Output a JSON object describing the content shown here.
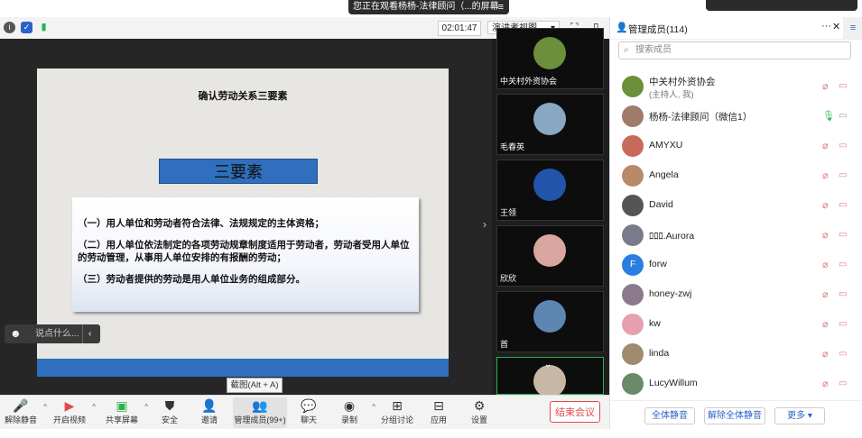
{
  "banner": {
    "share_text": "您正在观看杨杨-法律顾问（...的屏幕",
    "menu_icon": "≡"
  },
  "meeting_bar": {
    "timer": "02:01:47",
    "view_mode": "演讲者视图"
  },
  "slide": {
    "title": "确认劳动关系三要素",
    "banner": "三要素",
    "items": [
      "（一）用人单位和劳动者符合法律、法规规定的主体资格；",
      "（二）用人单位依法制定的各项劳动规章制度适用于劳动者，劳动者受用人单位的劳动管理，从事用人单位安排的有报酬的劳动；",
      "（三）劳动者提供的劳动是用人单位业务的组成部分。"
    ],
    "screenshot_tip": "截图(Alt + A)",
    "chat_placeholder": "说点什么..."
  },
  "thumbs": [
    {
      "name": "中关村外资协会",
      "color": "#6b8f3a"
    },
    {
      "name": "毛春英",
      "color": "#8aa7c4"
    },
    {
      "name": "王领",
      "color": "#2255aa"
    },
    {
      "name": "欣欣",
      "color": "#d9a6a0"
    },
    {
      "name": "首",
      "color": "#5d86b3"
    },
    {
      "name": "",
      "color": "#c9b7a5"
    }
  ],
  "panel": {
    "title": "管理成员(114)",
    "search_placeholder": "搜索成员",
    "members": [
      {
        "name": "中关村外资协会",
        "sub": "(主持人, 我)",
        "color": "#6b8f3a"
      },
      {
        "name": "杨杨-法律顾问（微信1）",
        "sub": "",
        "color": "#a07a6a"
      },
      {
        "name": "AMYXU",
        "sub": "",
        "color": "#c86a5a"
      },
      {
        "name": "Angela",
        "sub": "",
        "color": "#b88a6a"
      },
      {
        "name": "David",
        "sub": "",
        "color": "#555555"
      },
      {
        "name": "ﾛﾛﾛ.Aurora",
        "sub": "",
        "color": "#7a7a8a"
      },
      {
        "name": "forw",
        "sub": "",
        "color": "#2a7de1",
        "letter": "F"
      },
      {
        "name": "honey-zwj",
        "sub": "",
        "color": "#8a7a8a"
      },
      {
        "name": "kw",
        "sub": "",
        "color": "#e6a0b0"
      },
      {
        "name": "linda",
        "sub": "",
        "color": "#a08a70"
      },
      {
        "name": "LucyWillum",
        "sub": "",
        "color": "#6a8a6a"
      }
    ],
    "footer": {
      "mute_all": "全体静音",
      "unmute_all": "解除全体静音",
      "more": "更多"
    }
  },
  "toolbar": {
    "unmute": "解除静音",
    "start_video": "开启视频",
    "share_screen": "共享屏幕",
    "security": "安全",
    "invite": "邀请",
    "members": "管理成员(99+)",
    "chat": "聊天",
    "record": "录制",
    "breakout": "分组讨论",
    "apps": "应用",
    "settings": "设置",
    "end": "结束会议"
  }
}
